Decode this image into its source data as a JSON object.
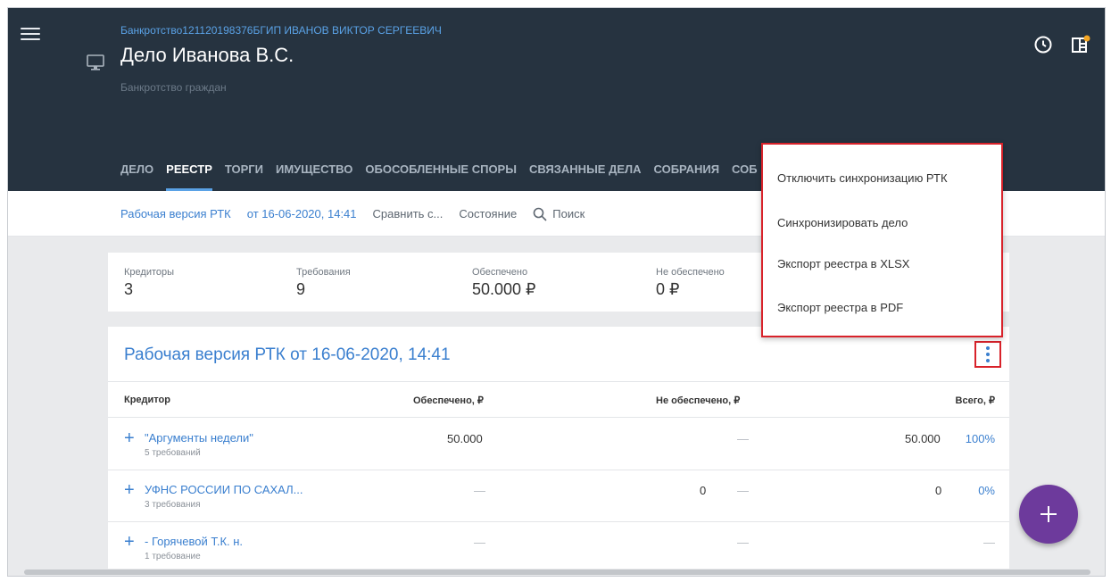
{
  "header": {
    "breadcrumb": "Банкротство121120198376БГИП ИВАНОВ ВИКТОР СЕРГЕЕВИЧ",
    "title": "Дело Иванова В.С.",
    "subtitle": "Банкротство граждан",
    "icons": [
      "menu-icon",
      "monitor-icon",
      "clock-icon",
      "panel-notification-icon"
    ]
  },
  "tabs": [
    {
      "label": "ДЕЛО",
      "active": false
    },
    {
      "label": "РЕЕСТР",
      "active": true
    },
    {
      "label": "ТОРГИ",
      "active": false
    },
    {
      "label": "ИМУЩЕСТВО",
      "active": false
    },
    {
      "label": "ОБОСОБЛЕННЫЕ СПОРЫ",
      "active": false
    },
    {
      "label": "СВЯЗАННЫЕ ДЕЛА",
      "active": false
    },
    {
      "label": "СОБРАНИЯ",
      "active": false
    },
    {
      "label": "СОБ",
      "active": false
    }
  ],
  "toolbar": {
    "version": "Рабочая версия РТК",
    "date": "от 16-06-2020, 14:41",
    "compare": "Сравнить с...",
    "state": "Состояние",
    "search": "Поиск"
  },
  "stats": [
    {
      "label": "Кредиторы",
      "value": "3"
    },
    {
      "label": "Требования",
      "value": "9"
    },
    {
      "label": "Обеспечено",
      "value": "50.000 ₽"
    },
    {
      "label": "Не обеспечено",
      "value": "0 ₽"
    }
  ],
  "registry": {
    "title": "Рабочая версия РТК от 16-06-2020, 14:41",
    "columns": [
      "Кредитор",
      "Обеспечено, ₽",
      "Не обеспечено, ₽",
      "Всего, ₽"
    ],
    "rows": [
      {
        "name": "\"Аргументы недели\"",
        "sub": "5 требований",
        "secured": "50.000",
        "unsecured_val": "",
        "unsecured": "—",
        "total": "50.000",
        "pct": "100%"
      },
      {
        "name": "УФНС РОССИИ ПО САХАЛ...",
        "sub": "3 требования",
        "secured": "—",
        "unsecured_val": "0",
        "unsecured": "—",
        "total": "0",
        "pct": "0%"
      },
      {
        "name": "- Горячевой Т.К. н.",
        "sub": "1 требование",
        "secured": "—",
        "unsecured_val": "",
        "unsecured": "—",
        "total": "",
        "pct": "—"
      }
    ]
  },
  "menu": {
    "items": [
      "Отключить синхронизацию РТК",
      "Синхронизировать дело",
      "Экспорт реестра в XLSX",
      "Экспорт реестра в PDF"
    ]
  },
  "colors": {
    "header_bg": "#263340",
    "accent": "#3a7fcf",
    "highlight": "#d8222a",
    "fab": "#6d3a9c"
  }
}
